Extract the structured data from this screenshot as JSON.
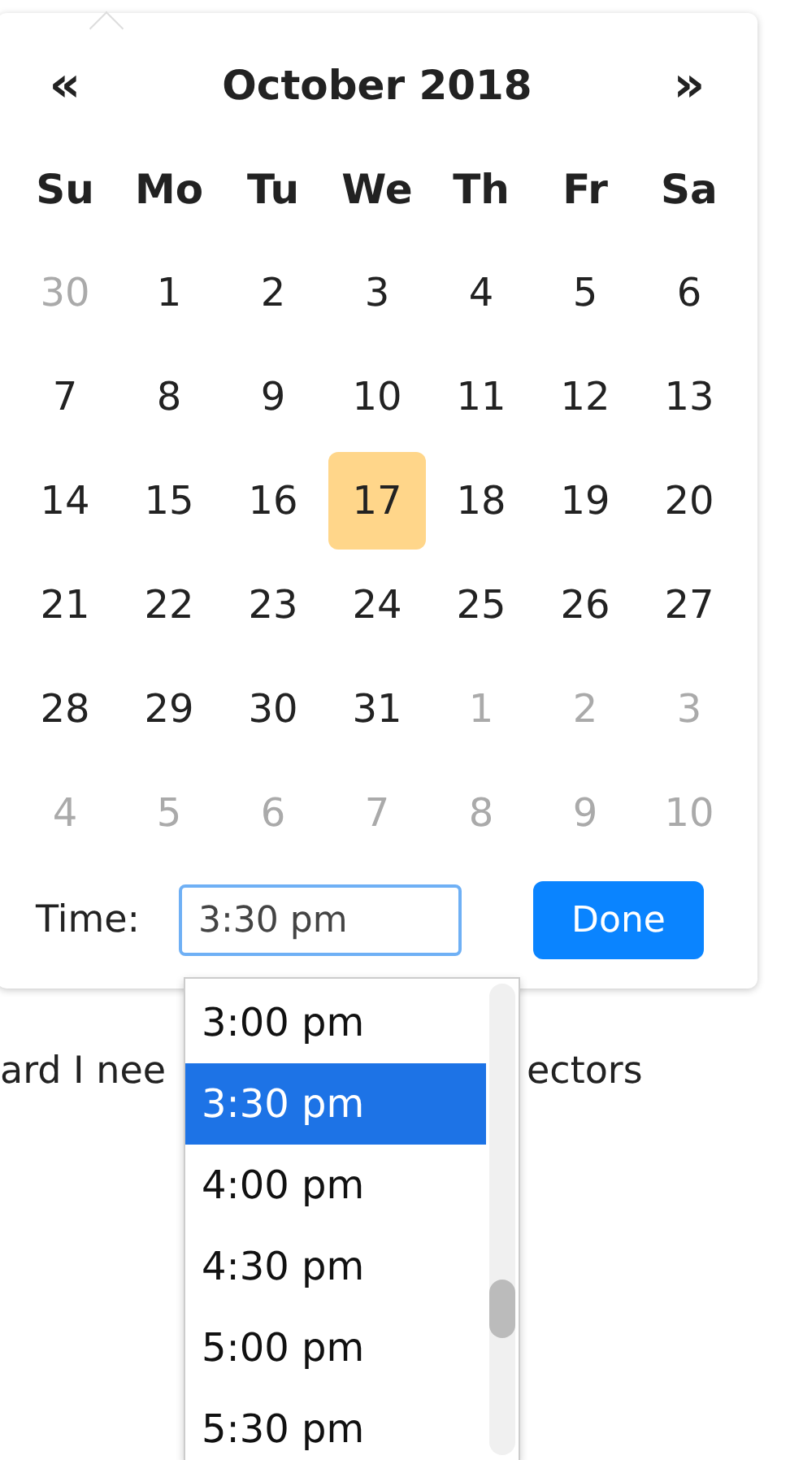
{
  "calendar": {
    "prev": "«",
    "title": "October 2018",
    "next": "»",
    "weekdays": [
      "Su",
      "Mo",
      "Tu",
      "We",
      "Th",
      "Fr",
      "Sa"
    ],
    "days": [
      {
        "label": "30",
        "muted": true,
        "selected": false
      },
      {
        "label": "1",
        "muted": false,
        "selected": false
      },
      {
        "label": "2",
        "muted": false,
        "selected": false
      },
      {
        "label": "3",
        "muted": false,
        "selected": false
      },
      {
        "label": "4",
        "muted": false,
        "selected": false
      },
      {
        "label": "5",
        "muted": false,
        "selected": false
      },
      {
        "label": "6",
        "muted": false,
        "selected": false
      },
      {
        "label": "7",
        "muted": false,
        "selected": false
      },
      {
        "label": "8",
        "muted": false,
        "selected": false
      },
      {
        "label": "9",
        "muted": false,
        "selected": false
      },
      {
        "label": "10",
        "muted": false,
        "selected": false
      },
      {
        "label": "11",
        "muted": false,
        "selected": false
      },
      {
        "label": "12",
        "muted": false,
        "selected": false
      },
      {
        "label": "13",
        "muted": false,
        "selected": false
      },
      {
        "label": "14",
        "muted": false,
        "selected": false
      },
      {
        "label": "15",
        "muted": false,
        "selected": false
      },
      {
        "label": "16",
        "muted": false,
        "selected": false
      },
      {
        "label": "17",
        "muted": false,
        "selected": true
      },
      {
        "label": "18",
        "muted": false,
        "selected": false
      },
      {
        "label": "19",
        "muted": false,
        "selected": false
      },
      {
        "label": "20",
        "muted": false,
        "selected": false
      },
      {
        "label": "21",
        "muted": false,
        "selected": false
      },
      {
        "label": "22",
        "muted": false,
        "selected": false
      },
      {
        "label": "23",
        "muted": false,
        "selected": false
      },
      {
        "label": "24",
        "muted": false,
        "selected": false
      },
      {
        "label": "25",
        "muted": false,
        "selected": false
      },
      {
        "label": "26",
        "muted": false,
        "selected": false
      },
      {
        "label": "27",
        "muted": false,
        "selected": false
      },
      {
        "label": "28",
        "muted": false,
        "selected": false
      },
      {
        "label": "29",
        "muted": false,
        "selected": false
      },
      {
        "label": "30",
        "muted": false,
        "selected": false
      },
      {
        "label": "31",
        "muted": false,
        "selected": false
      },
      {
        "label": "1",
        "muted": true,
        "selected": false
      },
      {
        "label": "2",
        "muted": true,
        "selected": false
      },
      {
        "label": "3",
        "muted": true,
        "selected": false
      },
      {
        "label": "4",
        "muted": true,
        "selected": false
      },
      {
        "label": "5",
        "muted": true,
        "selected": false
      },
      {
        "label": "6",
        "muted": true,
        "selected": false
      },
      {
        "label": "7",
        "muted": true,
        "selected": false
      },
      {
        "label": "8",
        "muted": true,
        "selected": false
      },
      {
        "label": "9",
        "muted": true,
        "selected": false
      },
      {
        "label": "10",
        "muted": true,
        "selected": false
      }
    ],
    "time_label": "Time:",
    "time_value": "3:30 pm",
    "done_button": "Done"
  },
  "time_options": [
    {
      "label": "3:00 pm",
      "selected": false
    },
    {
      "label": "3:30 pm",
      "selected": true
    },
    {
      "label": "4:00 pm",
      "selected": false
    },
    {
      "label": "4:30 pm",
      "selected": false
    },
    {
      "label": "5:00 pm",
      "selected": false
    },
    {
      "label": "5:30 pm",
      "selected": false
    }
  ],
  "background_text": [
    "ard I nee",
    "ectors"
  ]
}
